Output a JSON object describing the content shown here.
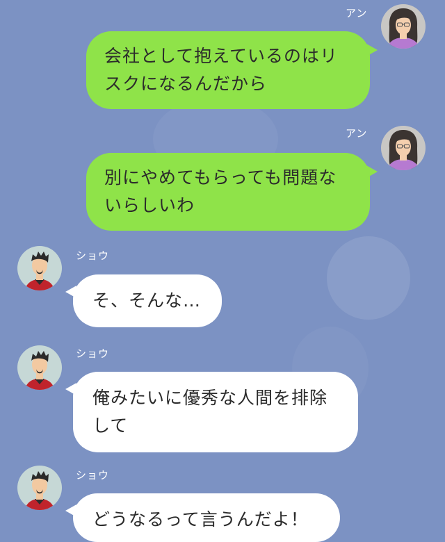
{
  "messages": [
    {
      "sender": "アン",
      "avatar_icon": "female-avatar-icon",
      "side": "right",
      "lines": [
        "会社として抱えているのはリ",
        "スクになるんだから"
      ]
    },
    {
      "sender": "アン",
      "avatar_icon": "female-avatar-icon",
      "side": "right",
      "lines": [
        "別にやめてもらっても問題な",
        "いらしいわ"
      ]
    },
    {
      "sender": "ショウ",
      "avatar_icon": "male-avatar-icon",
      "side": "left",
      "lines": [
        "そ、そんな…"
      ]
    },
    {
      "sender": "ショウ",
      "avatar_icon": "male-avatar-icon",
      "side": "left",
      "lines": [
        "俺みたいに優秀な人間を排除",
        "して"
      ]
    },
    {
      "sender": "ショウ",
      "avatar_icon": "male-avatar-icon",
      "side": "left",
      "lines": [
        "どうなるって言うんだよ！"
      ]
    }
  ],
  "colors": {
    "background": "#7c92c3",
    "outgoing_bubble": "#8fe349",
    "incoming_bubble": "#ffffff",
    "name_text": "#ffffff",
    "message_text": "#2b2b2b"
  }
}
